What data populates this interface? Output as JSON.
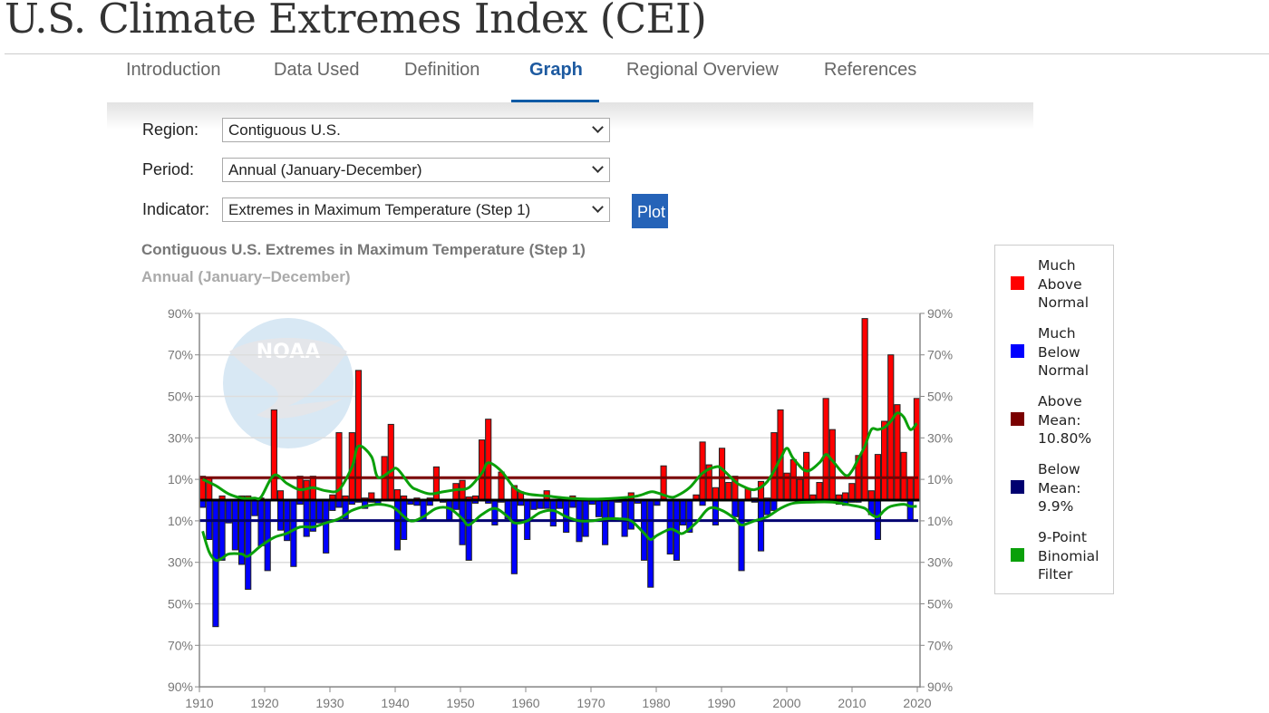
{
  "page": {
    "title": "U.S. Climate Extremes Index (CEI)"
  },
  "tabs": [
    {
      "label": "Introduction",
      "active": false
    },
    {
      "label": "Data Used",
      "active": false
    },
    {
      "label": "Definition",
      "active": false
    },
    {
      "label": "Graph",
      "active": true
    },
    {
      "label": "Regional Overview",
      "active": false
    },
    {
      "label": "References",
      "active": false
    }
  ],
  "form": {
    "region_label": "Region:",
    "region_value": "Contiguous U.S.",
    "period_label": "Period:",
    "period_value": "Annual (January-December)",
    "indicator_label": "Indicator:",
    "indicator_value": "Extremes in Maximum Temperature (Step 1)",
    "plot_label": "Plot"
  },
  "colors": {
    "much_above": "#ff0000",
    "much_below": "#0000ff",
    "above_mean": "#7a0000",
    "below_mean": "#000070",
    "filter": "#0aa00a",
    "active_tab": "#0b5aa5",
    "plot_button": "#2563b8"
  },
  "watermark": "NOAA",
  "chart_data": {
    "type": "bar",
    "title": "Contiguous U.S. Extremes in Maximum Temperature (Step 1)",
    "subtitle": "Annual (January–December)",
    "xlabel": "",
    "ylabel": "",
    "xlim": [
      1910,
      2020
    ],
    "ylim": [
      -90,
      90
    ],
    "x_ticks": [
      "1910",
      "1920",
      "1930",
      "1940",
      "1950",
      "1960",
      "1970",
      "1980",
      "1990",
      "2000",
      "2010",
      "2020"
    ],
    "y_ticks_left": [
      "90%",
      "70%",
      "50%",
      "30%",
      "10%",
      "10%",
      "30%",
      "50%",
      "70%",
      "90%"
    ],
    "y_ticks_right": [
      "90%",
      "70%",
      "50%",
      "30%",
      "10%",
      "10%",
      "30%",
      "50%",
      "70%",
      "90%"
    ],
    "grid": true,
    "legend_position": "right",
    "years_start": 1910,
    "series": [
      {
        "name": "Much Above Normal",
        "color": "#ff0000",
        "direction": "up",
        "values": [
          11.5,
          10.5,
          0,
          2,
          0,
          0,
          2,
          2,
          0,
          1,
          0,
          43.5,
          4.5,
          0,
          0,
          11.5,
          9.5,
          11.5,
          0,
          0,
          2.5,
          32.5,
          2,
          32.5,
          62.5,
          1,
          3.5,
          0.5,
          21,
          36.5,
          5,
          2,
          0,
          1,
          0,
          1,
          16,
          0,
          0,
          8,
          9.5,
          1.5,
          2,
          29,
          39,
          0,
          13.5,
          0,
          7,
          4,
          0,
          0,
          0,
          4.5,
          0,
          0,
          0,
          2,
          0,
          0,
          0,
          0,
          0,
          0,
          0,
          0,
          3.5,
          0,
          0,
          0,
          0,
          16.5,
          0,
          0,
          0,
          0,
          2.5,
          28,
          17,
          6,
          25,
          8.5,
          11.5,
          0,
          5.5,
          1,
          9,
          1,
          32.5,
          43.5,
          13,
          19.5,
          10,
          23,
          2.5,
          8.5,
          49,
          34,
          2.5,
          3.5,
          8,
          21.5,
          87.5,
          4.5,
          22,
          38,
          70,
          46,
          23,
          11,
          49
        ]
      },
      {
        "name": "Much Below Normal",
        "color": "#0000ff",
        "direction": "down",
        "values": [
          3.5,
          19,
          61,
          29,
          11,
          24,
          31,
          43,
          7.5,
          22,
          34,
          0,
          14.5,
          19.5,
          32,
          2,
          17.5,
          15,
          11,
          25.5,
          5,
          3.5,
          9,
          2,
          1,
          4,
          1,
          2,
          0,
          0,
          24,
          19,
          2,
          2.5,
          9.5,
          2.5,
          0,
          1,
          9.5,
          4.5,
          21.5,
          29,
          1.5,
          0,
          1.5,
          12,
          1,
          9,
          35.5,
          2.5,
          19,
          4.5,
          4,
          4,
          12.5,
          4,
          15.5,
          3.5,
          20,
          17.5,
          2,
          8,
          21.5,
          8.5,
          1,
          17.5,
          14,
          1.5,
          29,
          42,
          2.5,
          0,
          26,
          29,
          12,
          15.5,
          0,
          2.5,
          0,
          12,
          0,
          0,
          8,
          34,
          0,
          1,
          24.5,
          7,
          5,
          0,
          0,
          0,
          0,
          0,
          0,
          0,
          0,
          0,
          2,
          2.5,
          1,
          1,
          0,
          7,
          19,
          0,
          0,
          0,
          0.5,
          9.5,
          0
        ]
      },
      {
        "name": "Above Mean: 10.80%",
        "color": "#7a0000",
        "type": "hline",
        "value": 10.8
      },
      {
        "name": "Below Mean: 9.9%",
        "color": "#000070",
        "type": "hline",
        "value": -9.9
      },
      {
        "name": "9-Point Binomial Filter (above)",
        "color": "#0aa00a",
        "type": "line",
        "x": [
          1910,
          1912,
          1914,
          1916,
          1918,
          1919,
          1921,
          1923,
          1925,
          1927,
          1929,
          1931,
          1933,
          1934,
          1936,
          1937,
          1939,
          1940,
          1942,
          1943,
          1945,
          1947,
          1949,
          1951,
          1953,
          1954,
          1956,
          1958,
          1960,
          1963,
          1966,
          1970,
          1974,
          1977,
          1979,
          1980,
          1982,
          1983,
          1985,
          1987,
          1989,
          1990,
          1992,
          1993,
          1995,
          1997,
          1999,
          2000,
          2001,
          2003,
          2005,
          2006,
          2007,
          2009,
          2010,
          2011,
          2012,
          2013,
          2014,
          2015,
          2016,
          2017,
          2018,
          2019,
          2020
        ],
        "values": [
          10,
          7,
          3,
          1,
          1,
          1.5,
          12,
          8,
          5,
          6,
          4.5,
          5,
          16,
          26,
          21,
          11,
          14,
          15,
          7,
          5,
          3,
          4,
          5,
          6,
          13,
          18,
          14,
          6,
          3,
          2,
          1,
          0.5,
          1,
          2,
          4,
          3.5,
          1.5,
          2,
          6,
          13,
          16,
          15,
          9,
          7,
          5,
          9,
          20,
          25,
          20,
          14,
          18,
          22,
          19,
          12,
          14,
          20,
          26,
          34,
          34,
          35,
          38,
          42,
          40,
          34,
          37
        ]
      },
      {
        "name": "9-Point Binomial Filter (below)",
        "color": "#0aa00a",
        "type": "line",
        "x": [
          1910,
          1911,
          1912,
          1913,
          1914,
          1916,
          1917,
          1919,
          1921,
          1923,
          1925,
          1927,
          1929,
          1931,
          1933,
          1935,
          1937,
          1939,
          1940,
          1942,
          1944,
          1946,
          1948,
          1950,
          1951,
          1953,
          1955,
          1957,
          1958,
          1960,
          1962,
          1964,
          1966,
          1968,
          1970,
          1972,
          1974,
          1976,
          1978,
          1979,
          1980,
          1982,
          1983,
          1984,
          1986,
          1988,
          1990,
          1992,
          1993,
          1995,
          1997,
          1999,
          2001,
          2004,
          2007,
          2010,
          2012,
          2013,
          2014,
          2015,
          2016,
          2018,
          2019,
          2020
        ],
        "values": [
          -15,
          -25,
          -29,
          -28,
          -26,
          -26,
          -27,
          -22,
          -18,
          -16,
          -13,
          -13,
          -11,
          -9,
          -5,
          -3,
          -2,
          -3,
          -5,
          -10,
          -8,
          -4,
          -4,
          -9,
          -12,
          -7,
          -4,
          -8,
          -11,
          -10,
          -6,
          -5,
          -8,
          -10,
          -10,
          -9,
          -9,
          -10,
          -16,
          -19,
          -17,
          -14,
          -15,
          -16,
          -11,
          -4,
          -5,
          -9,
          -12,
          -10,
          -8,
          -4,
          -1.5,
          -1,
          -1,
          -2.5,
          -4,
          -7,
          -8,
          -5,
          -3,
          -2,
          -3,
          -3
        ]
      }
    ]
  },
  "legend": [
    {
      "label": "Much\nAbove\nNormal",
      "color": "#ff0000"
    },
    {
      "label": "Much\nBelow\nNormal",
      "color": "#0000ff"
    },
    {
      "label": "Above\nMean:\n10.80%",
      "color": "#7a0000"
    },
    {
      "label": "Below\nMean:\n9.9%",
      "color": "#000070"
    },
    {
      "label": "9-Point\nBinomial\nFilter",
      "color": "#0aa00a"
    }
  ]
}
